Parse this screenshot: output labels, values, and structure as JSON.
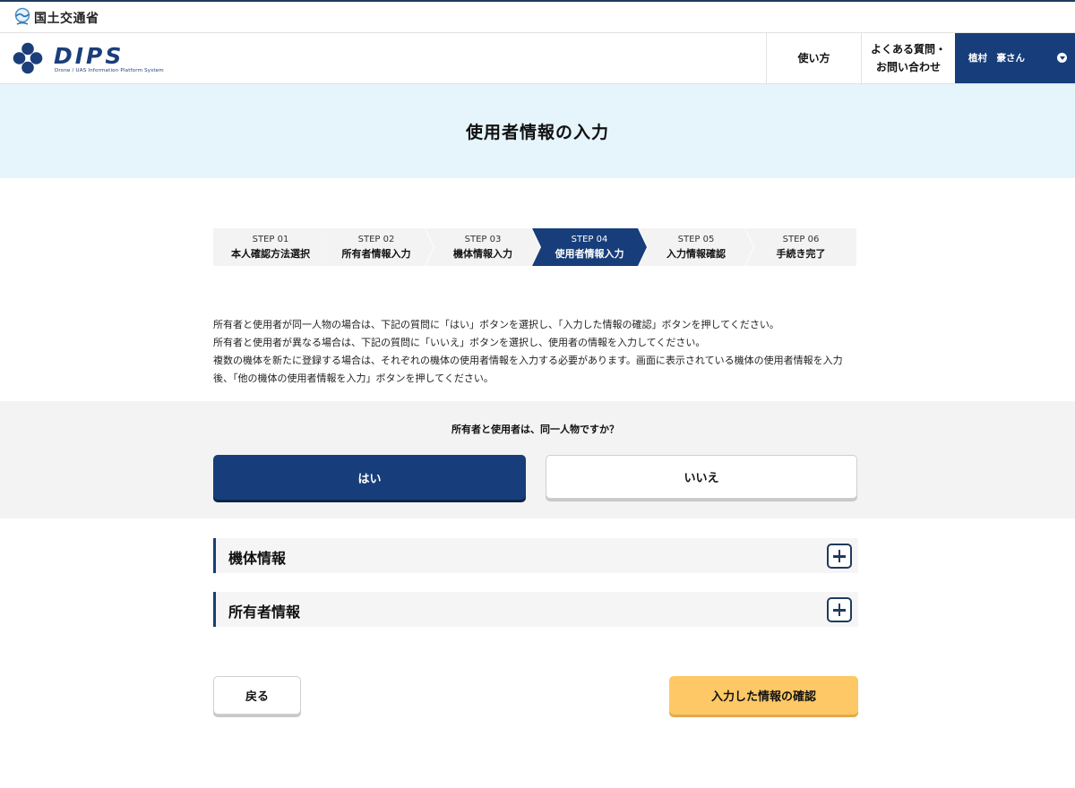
{
  "gov_bar": {
    "ministry_name": "国土交通省",
    "logo_icon": "mlit-wave-icon"
  },
  "header": {
    "logo_text": "DIPS",
    "logo_subtitle": "Drone / UAS Information Platform System",
    "logo_icon": "dips-diamond-logo",
    "nav": {
      "usage": "使い方",
      "faq_line1": "よくある質問・",
      "faq_line2": "お問い合わせ",
      "user_name": "植村　豪さん",
      "user_caret_icon": "chevron-down-circle-icon"
    }
  },
  "page": {
    "title": "使用者情報の入力"
  },
  "stepper": {
    "steps": [
      {
        "number": "STEP 01",
        "label": "本人確認方法選択"
      },
      {
        "number": "STEP 02",
        "label": "所有者情報入力"
      },
      {
        "number": "STEP 03",
        "label": "機体情報入力"
      },
      {
        "number": "STEP 04",
        "label": "使用者情報入力"
      },
      {
        "number": "STEP 05",
        "label": "入力情報確認"
      },
      {
        "number": "STEP 06",
        "label": "手続き完了"
      }
    ],
    "active_step": "STEP 04"
  },
  "instructions": {
    "line1": "所有者と使用者が同一人物の場合は、下記の質問に「はい」ボタンを選択し、「入力した情報の確認」ボタンを押してください。",
    "line2": "所有者と使用者が異なる場合は、下記の質問に「いいえ」ボタンを選択し、使用者の情報を入力してください。",
    "line3": "複数の機体を新たに登録する場合は、それぞれの機体の使用者情報を入力する必要があります。画面に表示されている機体の使用者情報を入力",
    "line4": "後、「他の機体の使用者情報を入力」ボタンを押してください。"
  },
  "question": {
    "text": "所有者と使用者は、同一人物ですか？",
    "yes_label": "はい",
    "no_label": "いいえ",
    "selected": "はい"
  },
  "accordions": {
    "machine_title": "機体情報",
    "owner_title": "所有者情報",
    "expand_icon": "plus-square-icon"
  },
  "footer_buttons": {
    "back_label": "戻る",
    "confirm_label": "入力した情報の確認"
  },
  "colors": {
    "primary": "#173e7a",
    "title_band": "#e6f4fc",
    "panel_gray": "#f3f3f3",
    "confirm_yellow": "#fdc865"
  }
}
